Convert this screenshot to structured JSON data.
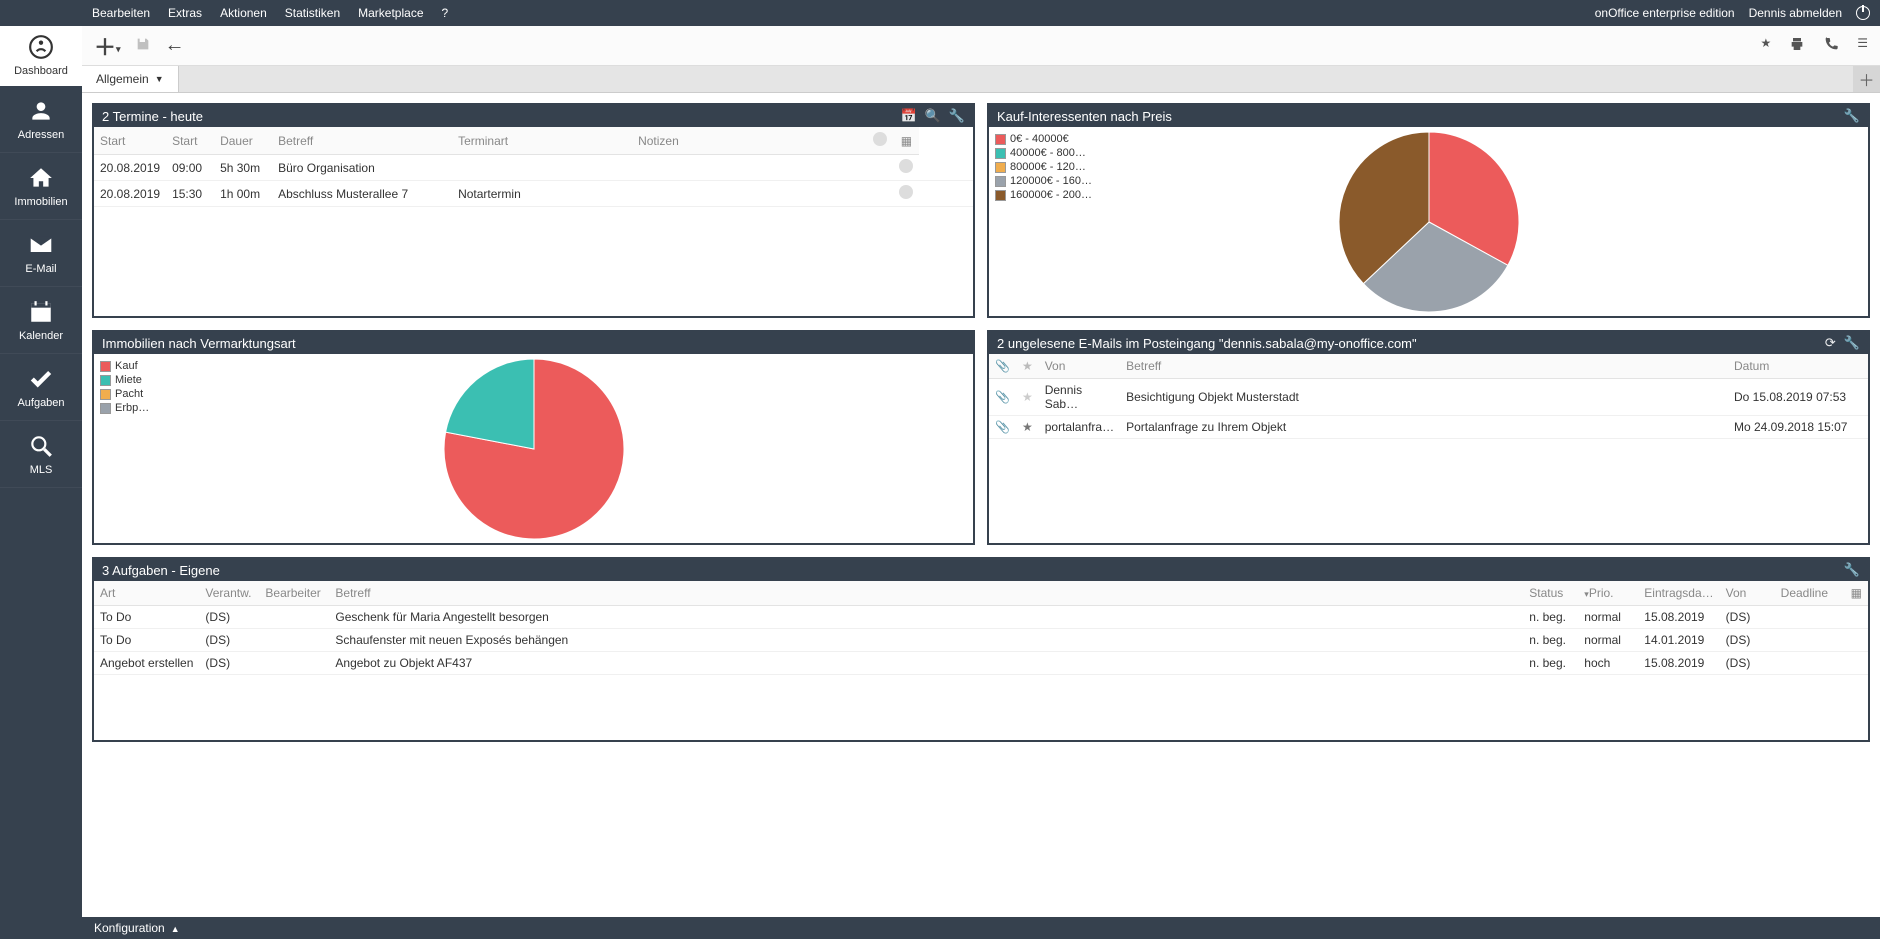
{
  "topmenu": {
    "items": [
      "Bearbeiten",
      "Extras",
      "Aktionen",
      "Statistiken",
      "Marketplace",
      "?"
    ],
    "edition": "onOffice enterprise edition",
    "logout": "Dennis abmelden"
  },
  "sidebar": {
    "items": [
      {
        "label": "Dashboard"
      },
      {
        "label": "Adressen"
      },
      {
        "label": "Immobilien"
      },
      {
        "label": "E-Mail"
      },
      {
        "label": "Kalender"
      },
      {
        "label": "Aufgaben"
      },
      {
        "label": "MLS"
      }
    ]
  },
  "tabs": {
    "active": "Allgemein"
  },
  "footer": {
    "config": "Konfiguration"
  },
  "widgets": {
    "termine": {
      "title": "2 Termine - heute",
      "cols": [
        "Start",
        "Start",
        "Dauer",
        "Betreff",
        "Terminart",
        "Notizen",
        "",
        ""
      ],
      "rows": [
        {
          "c": [
            "20.08.2019",
            "09:00",
            "5h 30m",
            "Büro Organisation",
            "",
            "",
            ""
          ]
        },
        {
          "c": [
            "20.08.2019",
            "15:30",
            "1h 00m",
            "Abschluss Musterallee 7",
            "Notartermin",
            "",
            ""
          ]
        }
      ]
    },
    "kauf": {
      "title": "Kauf-Interessenten nach Preis",
      "legend": [
        {
          "label": "0€ - 40000€",
          "color": "#ec5b5b"
        },
        {
          "label": "40000€ - 800…",
          "color": "#3bbfb2"
        },
        {
          "label": "80000€ - 120…",
          "color": "#f0ad4e"
        },
        {
          "label": "120000€ - 160…",
          "color": "#9aa2ab"
        },
        {
          "label": "160000€ - 200…",
          "color": "#8a5a2b"
        }
      ]
    },
    "immo": {
      "title": "Immobilien nach Vermarktungsart",
      "legend": [
        {
          "label": "Kauf",
          "color": "#ec5b5b"
        },
        {
          "label": "Miete",
          "color": "#3bbfb2"
        },
        {
          "label": "Pacht",
          "color": "#f0ad4e"
        },
        {
          "label": "Erbp…",
          "color": "#9aa2ab"
        }
      ]
    },
    "emails": {
      "title": "2 ungelesene E-Mails im Posteingang \"dennis.sabala@my-onoffice.com\"",
      "cols": [
        "",
        "",
        "Von",
        "Betreff",
        "Datum"
      ],
      "rows": [
        {
          "von": "Dennis Sab…",
          "betreff": "Besichtigung Objekt Musterstadt",
          "datum": "Do 15.08.2019 07:53",
          "star": false
        },
        {
          "von": "portalanfra…",
          "betreff": "Portalanfrage zu Ihrem Objekt",
          "datum": "Mo 24.09.2018 15:07",
          "star": true
        }
      ]
    },
    "tasks": {
      "title": "3 Aufgaben - Eigene",
      "cols": [
        "Art",
        "Verantw.",
        "Bearbeiter",
        "Betreff",
        "Status",
        "Prio.",
        "Eintragsda…",
        "Von",
        "Deadline"
      ],
      "rows": [
        {
          "c": [
            "To Do",
            "(DS)",
            "",
            "Geschenk für Maria Angestellt besorgen",
            "n. beg.",
            "normal",
            "15.08.2019",
            "(DS)",
            ""
          ]
        },
        {
          "c": [
            "To Do",
            "(DS)",
            "",
            "Schaufenster mit neuen Exposés behängen",
            "n. beg.",
            "normal",
            "14.01.2019",
            "(DS)",
            ""
          ]
        },
        {
          "c": [
            "Angebot erstellen",
            "(DS)",
            "",
            "Angebot zu Objekt AF437",
            "n. beg.",
            "hoch",
            "15.08.2019",
            "(DS)",
            ""
          ]
        }
      ]
    }
  },
  "chart_data": [
    {
      "type": "pie",
      "title": "Kauf-Interessenten nach Preis",
      "categories": [
        "0€ - 40000€",
        "40000€ - 80000€",
        "80000€ - 120000€",
        "120000€ - 160000€",
        "160000€ - 200000€"
      ],
      "values": [
        33,
        0,
        0,
        30,
        37
      ],
      "colors": [
        "#ec5b5b",
        "#3bbfb2",
        "#f0ad4e",
        "#9aa2ab",
        "#8a5a2b"
      ]
    },
    {
      "type": "pie",
      "title": "Immobilien nach Vermarktungsart",
      "categories": [
        "Kauf",
        "Miete",
        "Pacht",
        "Erbpacht"
      ],
      "values": [
        78,
        22,
        0,
        0
      ],
      "colors": [
        "#ec5b5b",
        "#3bbfb2",
        "#f0ad4e",
        "#9aa2ab"
      ]
    }
  ]
}
